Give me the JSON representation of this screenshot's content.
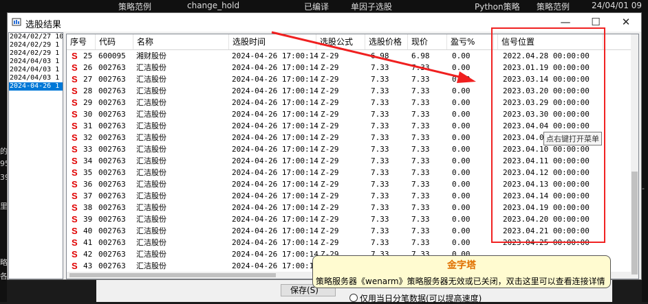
{
  "background": {
    "top_items": [
      "策略范例",
      "change_hold",
      "已编译",
      "单因子选股",
      "Python策略",
      "策略范例",
      "24/04/01 09"
    ],
    "left_fragments": [
      "的",
      "95",
      "39",
      "里",
      "略",
      "各"
    ],
    "right_fragments": [
      "-"
    ]
  },
  "window": {
    "title": "选股结果",
    "minimize": "—",
    "maximize": "☐",
    "close": "✕"
  },
  "date_list": [
    {
      "text": "2024/02/27 10",
      "selected": false
    },
    {
      "text": "2024/02/29 1",
      "selected": false
    },
    {
      "text": "2024/02/29 1",
      "selected": false
    },
    {
      "text": "2024/04/03 1",
      "selected": false
    },
    {
      "text": "2024/04/03 1",
      "selected": false
    },
    {
      "text": "2024/04/03 1",
      "selected": false
    },
    {
      "text": "2024-04-26 1",
      "selected": true
    }
  ],
  "table": {
    "headers": [
      "序号",
      "代码",
      "名称",
      "选股时间",
      "选股公式",
      "选股价格",
      "现价",
      "盈亏%",
      "",
      "信号位置"
    ],
    "rows": [
      {
        "flag": "S",
        "no": "25",
        "code": "600095",
        "name": "湘财股份",
        "time": "2024-04-26 17:00:14",
        "formula": "Z-29",
        "price": "6.98",
        "now": "6.98",
        "pnl": "0.00",
        "signal": "2022.04.28 00:00:00"
      },
      {
        "flag": "S",
        "no": "26",
        "code": "002763",
        "name": "汇洁股份",
        "time": "2024-04-26 17:00:14",
        "formula": "Z-29",
        "price": "7.33",
        "now": "7.33",
        "pnl": "0.00",
        "signal": "2023.01.19 00:00:00"
      },
      {
        "flag": "S",
        "no": "27",
        "code": "002763",
        "name": "汇洁股份",
        "time": "2024-04-26 17:00:14",
        "formula": "Z-29",
        "price": "7.33",
        "now": "7.33",
        "pnl": "0.00",
        "signal": "2023.03.14 00:00:00"
      },
      {
        "flag": "S",
        "no": "28",
        "code": "002763",
        "name": "汇洁股份",
        "time": "2024-04-26 17:00:14",
        "formula": "Z-29",
        "price": "7.33",
        "now": "7.33",
        "pnl": "0.00",
        "signal": "2023.03.20 00:00:00"
      },
      {
        "flag": "S",
        "no": "29",
        "code": "002763",
        "name": "汇洁股份",
        "time": "2024-04-26 17:00:14",
        "formula": "Z-29",
        "price": "7.33",
        "now": "7.33",
        "pnl": "0.00",
        "signal": "2023.03.29 00:00:00"
      },
      {
        "flag": "S",
        "no": "30",
        "code": "002763",
        "name": "汇洁股份",
        "time": "2024-04-26 17:00:14",
        "formula": "Z-29",
        "price": "7.33",
        "now": "7.33",
        "pnl": "0.00",
        "signal": "2023.03.30 00:00:00"
      },
      {
        "flag": "S",
        "no": "31",
        "code": "002763",
        "name": "汇洁股份",
        "time": "2024-04-26 17:00:14",
        "formula": "Z-29",
        "price": "7.33",
        "now": "7.33",
        "pnl": "0.00",
        "signal": "2023.04.04 00:00:00"
      },
      {
        "flag": "S",
        "no": "32",
        "code": "002763",
        "name": "汇洁股份",
        "time": "2024-04-26 17:00:14",
        "formula": "Z-29",
        "price": "7.33",
        "now": "7.33",
        "pnl": "0.00",
        "signal": "2023.04.06"
      },
      {
        "flag": "S",
        "no": "33",
        "code": "002763",
        "name": "汇洁股份",
        "time": "2024-04-26 17:00:14",
        "formula": "Z-29",
        "price": "7.33",
        "now": "7.33",
        "pnl": "0.00",
        "signal": "2023.04.10 00:00:00"
      },
      {
        "flag": "S",
        "no": "34",
        "code": "002763",
        "name": "汇洁股份",
        "time": "2024-04-26 17:00:14",
        "formula": "Z-29",
        "price": "7.33",
        "now": "7.33",
        "pnl": "0.00",
        "signal": "2023.04.11 00:00:00"
      },
      {
        "flag": "S",
        "no": "35",
        "code": "002763",
        "name": "汇洁股份",
        "time": "2024-04-26 17:00:14",
        "formula": "Z-29",
        "price": "7.33",
        "now": "7.33",
        "pnl": "0.00",
        "signal": "2023.04.12 00:00:00"
      },
      {
        "flag": "S",
        "no": "36",
        "code": "002763",
        "name": "汇洁股份",
        "time": "2024-04-26 17:00:14",
        "formula": "Z-29",
        "price": "7.33",
        "now": "7.33",
        "pnl": "0.00",
        "signal": "2023.04.13 00:00:00"
      },
      {
        "flag": "S",
        "no": "37",
        "code": "002763",
        "name": "汇洁股份",
        "time": "2024-04-26 17:00:14",
        "formula": "Z-29",
        "price": "7.33",
        "now": "7.33",
        "pnl": "0.00",
        "signal": "2023.04.14 00:00:00"
      },
      {
        "flag": "S",
        "no": "38",
        "code": "002763",
        "name": "汇洁股份",
        "time": "2024-04-26 17:00:14",
        "formula": "Z-29",
        "price": "7.33",
        "now": "7.33",
        "pnl": "0.00",
        "signal": "2023.04.19 00:00:00"
      },
      {
        "flag": "S",
        "no": "39",
        "code": "002763",
        "name": "汇洁股份",
        "time": "2024-04-26 17:00:14",
        "formula": "Z-29",
        "price": "7.33",
        "now": "7.33",
        "pnl": "0.00",
        "signal": "2023.04.20 00:00:00"
      },
      {
        "flag": "S",
        "no": "40",
        "code": "002763",
        "name": "汇洁股份",
        "time": "2024-04-26 17:00:14",
        "formula": "Z-29",
        "price": "7.33",
        "now": "7.33",
        "pnl": "0.00",
        "signal": "2023.04.21 00:00:00"
      },
      {
        "flag": "S",
        "no": "41",
        "code": "002763",
        "name": "汇洁股份",
        "time": "2024-04-26 17:00:14",
        "formula": "Z-29",
        "price": "7.33",
        "now": "7.33",
        "pnl": "0.00",
        "signal": "2023.04.25 00:00:00"
      },
      {
        "flag": "S",
        "no": "42",
        "code": "002763",
        "name": "汇洁股份",
        "time": "2024-04-26 17:00:14",
        "formula": "Z-29",
        "price": "7.33",
        "now": "7.33",
        "pnl": "0.00",
        "signal": ""
      },
      {
        "flag": "S",
        "no": "43",
        "code": "002763",
        "name": "汇洁股份",
        "time": "2024-04-26 17:00:14",
        "formula": "Z-29",
        "price": "7.33",
        "now": "7.33",
        "pnl": "0.00",
        "signal": ""
      }
    ]
  },
  "tooltip": "点右键打开菜单",
  "bottom": {
    "save_label": "保存(S)",
    "radio_label": "仅用当日分笔数据(可以提高速度)"
  },
  "notice": {
    "title": "金字塔",
    "text": "策略服务器《wenarm》策略服务器无效或已关闭，双击这里可以查看连接详情"
  },
  "colors": {
    "annotation_red": "#f02020",
    "flag_red": "#e00000",
    "selection_blue": "#0078d7",
    "notice_title": "#e07000"
  }
}
